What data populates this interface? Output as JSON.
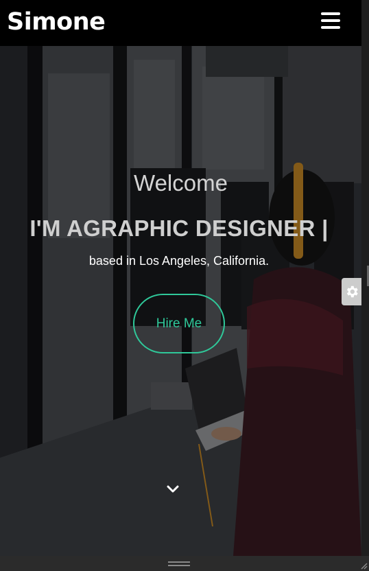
{
  "navbar": {
    "brand": "Simone",
    "menu_icon": "hamburger-menu-icon"
  },
  "hero": {
    "welcome": "Welcome",
    "headline": "I'M AGRAPHIC DESIGNER |",
    "subline": "based in Los Angeles, California.",
    "hire_button": "Hire Me",
    "scroll_icon": "chevron-down-icon",
    "background_image": "woman with headphones working at computer in office"
  },
  "settings": {
    "icon": "gear-icon"
  },
  "colors": {
    "accent": "#2fc99a",
    "navbar_bg": "#000000",
    "text_light": "#ffffff"
  }
}
